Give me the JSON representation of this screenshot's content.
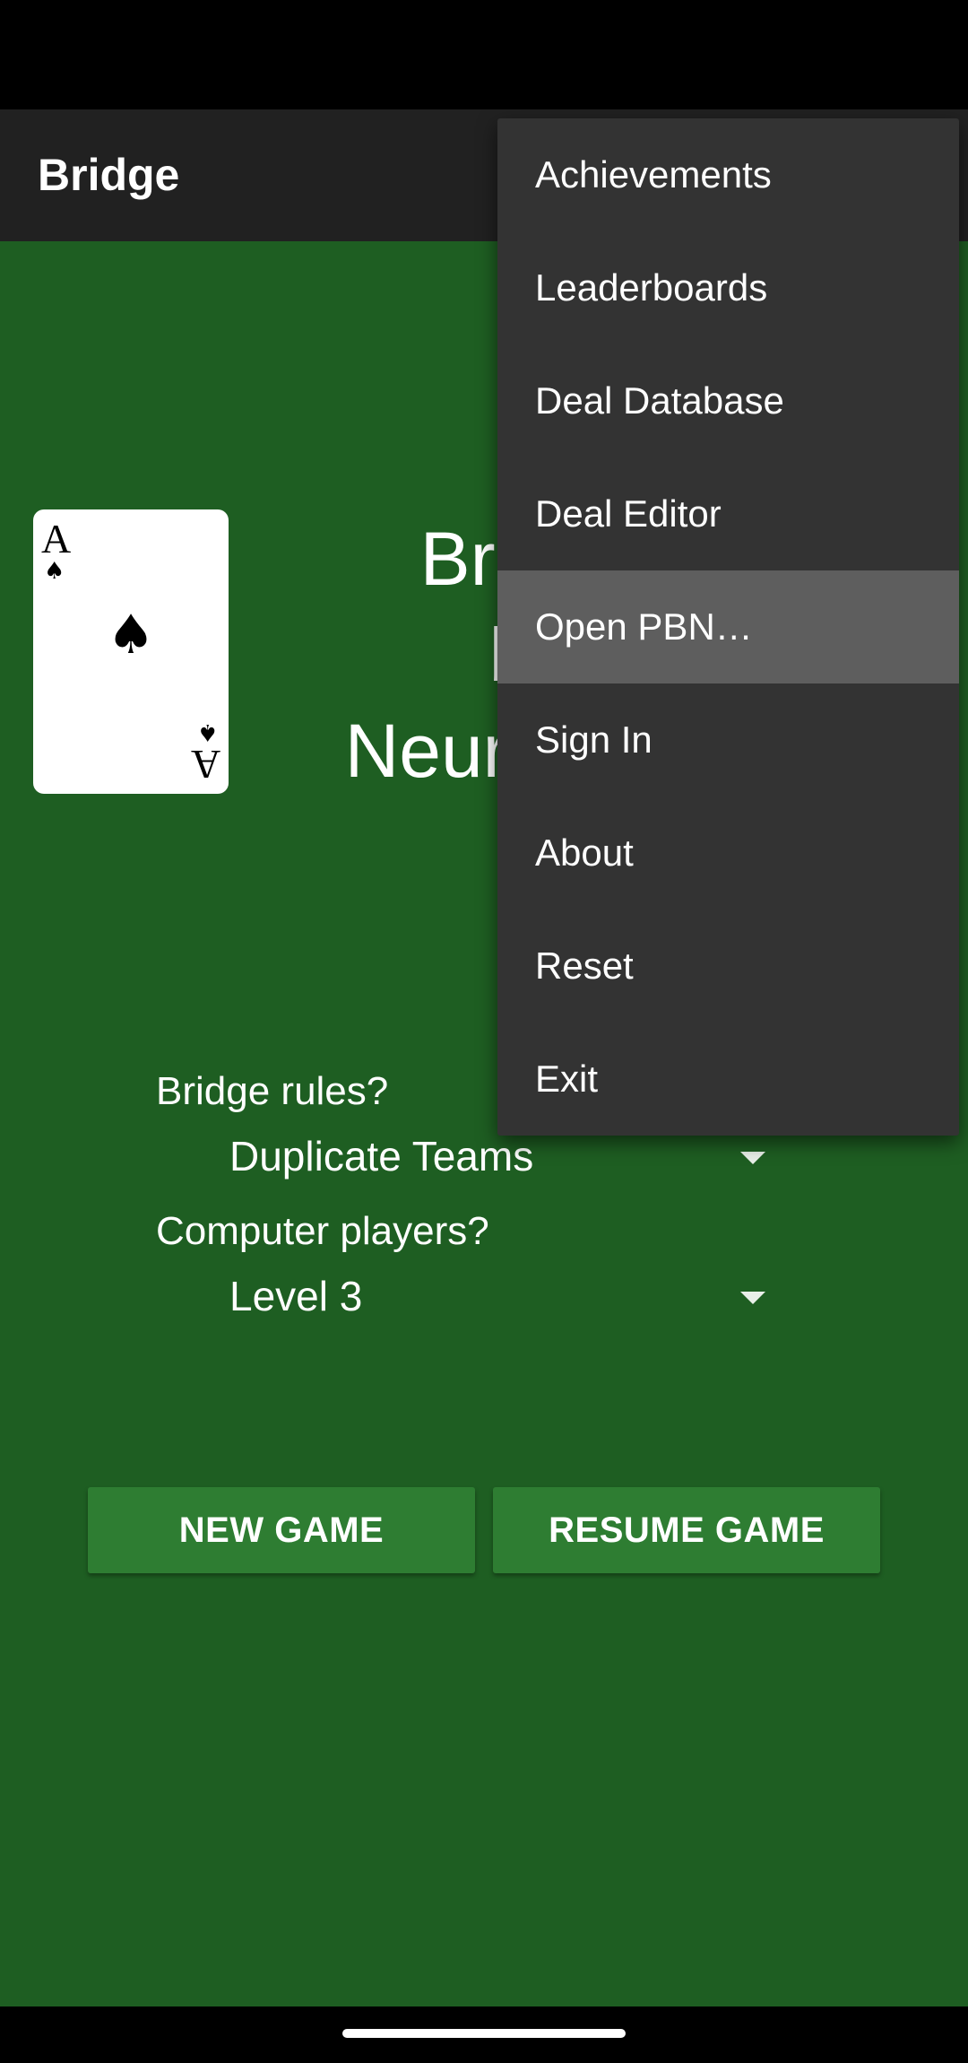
{
  "app_bar": {
    "title": "Bridge"
  },
  "splash": {
    "line1": "Bridge",
    "line2": "by",
    "line3": "NeuralPlay"
  },
  "card": {
    "rank": "A",
    "suit_symbol": "♠"
  },
  "settings": {
    "rules_label": "Bridge rules?",
    "rules_value": "Duplicate Teams",
    "players_label": "Computer players?",
    "players_value": "Level 3"
  },
  "buttons": {
    "new_game": "NEW GAME",
    "resume_game": "RESUME GAME"
  },
  "menu": {
    "items": [
      {
        "label": "Achievements"
      },
      {
        "label": "Leaderboards"
      },
      {
        "label": "Deal Database"
      },
      {
        "label": "Deal Editor"
      },
      {
        "label": "Open PBN…"
      },
      {
        "label": "Sign In"
      },
      {
        "label": "About"
      },
      {
        "label": "Reset"
      },
      {
        "label": "Exit"
      }
    ],
    "highlighted_index": 4
  },
  "colors": {
    "background_green": "#1e5e22",
    "button_green": "#2e7d32",
    "app_bar": "#212121",
    "menu_bg": "#333333",
    "menu_highlight": "#5e5e5e"
  }
}
